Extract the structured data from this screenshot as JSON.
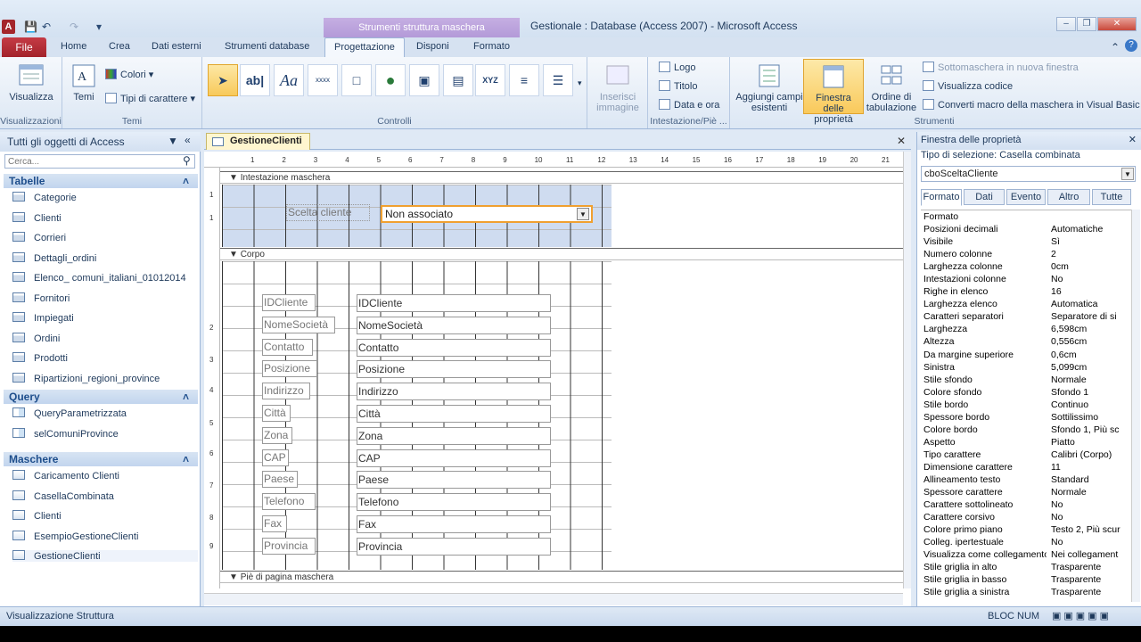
{
  "title_bar": {
    "window_title": "Gestionale : Database (Access 2007)  -  Microsoft Access",
    "context_tab_header": "Strumenti struttura maschera",
    "app_icon": "A"
  },
  "ribbon_tabs": {
    "file": "File",
    "tabs": [
      "Home",
      "Crea",
      "Dati esterni",
      "Strumenti database",
      "Progettazione",
      "Disponi",
      "Formato"
    ],
    "active": "Progettazione"
  },
  "ribbon": {
    "visualizzazioni": {
      "label": "Visualizzazioni",
      "button": "Visualizza"
    },
    "temi": {
      "label": "Temi",
      "temi_button": "Temi",
      "colori": "Colori",
      "tipi_carattere": "Tipi di carattere"
    },
    "controlli": {
      "label": "Controlli",
      "inserisci_immagine": "Inserisci immagine"
    },
    "intestazione": {
      "label": "Intestazione/Piè ...",
      "logo": "Logo",
      "titolo": "Titolo",
      "data_ora": "Data e ora"
    },
    "strumenti": {
      "label": "Strumenti",
      "aggiungi": "Aggiungi campi esistenti",
      "finestra": "Finestra delle proprietà",
      "ordine": "Ordine di tabulazione",
      "sottomaschera": "Sottomaschera in nuova finestra",
      "visualizza_codice": "Visualizza codice",
      "converti": "Converti macro della maschera in Visual Basic"
    }
  },
  "nav": {
    "header": "Tutti gli oggetti di Access",
    "search_placeholder": "Cerca...",
    "sections": [
      {
        "title": "Tabelle",
        "items": [
          "Categorie",
          "Clienti",
          "Corrieri",
          "Dettagli_ordini",
          "Elenco_ comuni_italiani_01012014",
          "Fornitori",
          "Impiegati",
          "Ordini",
          "Prodotti",
          "Ripartizioni_regioni_province"
        ]
      },
      {
        "title": "Query",
        "items": [
          "QueryParametrizzata",
          "selComuniProvince"
        ]
      },
      {
        "title": "Maschere",
        "items": [
          "Caricamento Clienti",
          "CasellaCombinata",
          "Clienti",
          "EsempioGestioneClienti",
          "GestioneClienti"
        ]
      }
    ]
  },
  "document": {
    "tab": "GestioneClienti",
    "sections": {
      "header": "Intestazione maschera",
      "body": "Corpo",
      "footer": "Piè di pagina maschera"
    },
    "header_label": "Scelta cliente",
    "combo_value": "Non associato",
    "fields": [
      {
        "label": "IDCliente",
        "value": "IDCliente"
      },
      {
        "label": "NomeSocietà",
        "value": "NomeSocietà"
      },
      {
        "label": "Contatto",
        "value": "Contatto"
      },
      {
        "label": "Posizione",
        "value": "Posizione"
      },
      {
        "label": "Indirizzo",
        "value": "Indirizzo"
      },
      {
        "label": "Città",
        "value": "Città"
      },
      {
        "label": "Zona",
        "value": "Zona"
      },
      {
        "label": "CAP",
        "value": "CAP"
      },
      {
        "label": "Paese",
        "value": "Paese"
      },
      {
        "label": "Telefono",
        "value": "Telefono"
      },
      {
        "label": "Fax",
        "value": "Fax"
      },
      {
        "label": "Provincia",
        "value": "Provincia"
      }
    ],
    "ruler_numbers": [
      "1",
      "2",
      "3",
      "4",
      "5",
      "6",
      "7",
      "8",
      "9",
      "10",
      "11",
      "12",
      "13",
      "14",
      "15",
      "16",
      "17",
      "18",
      "19",
      "20",
      "21"
    ],
    "vruler_numbers": [
      "1",
      "1",
      "2",
      "3",
      "4",
      "5",
      "6",
      "7",
      "8",
      "9"
    ]
  },
  "properties": {
    "title": "Finestra delle proprietà",
    "selection_type_label": "Tipo di selezione:  Casella combinata",
    "selected_control": "cboSceltaCliente",
    "tabs": [
      "Formato",
      "Dati",
      "Evento",
      "Altro",
      "Tutte"
    ],
    "active_tab": "Formato",
    "rows": [
      [
        "Formato",
        ""
      ],
      [
        "Posizioni decimali",
        "Automatiche"
      ],
      [
        "Visibile",
        "Sì"
      ],
      [
        "Numero colonne",
        "2"
      ],
      [
        "Larghezza colonne",
        "0cm"
      ],
      [
        "Intestazioni colonne",
        "No"
      ],
      [
        "Righe in elenco",
        "16"
      ],
      [
        "Larghezza elenco",
        "Automatica"
      ],
      [
        "Caratteri separatori",
        "Separatore di si"
      ],
      [
        "Larghezza",
        "6,598cm"
      ],
      [
        "Altezza",
        "0,556cm"
      ],
      [
        "Da margine superiore",
        "0,6cm"
      ],
      [
        "Sinistra",
        "5,099cm"
      ],
      [
        "Stile sfondo",
        "Normale"
      ],
      [
        "Colore sfondo",
        "Sfondo 1"
      ],
      [
        "Stile bordo",
        "Continuo"
      ],
      [
        "Spessore bordo",
        "Sottilissimo"
      ],
      [
        "Colore bordo",
        "Sfondo 1, Più sc"
      ],
      [
        "Aspetto",
        "Piatto"
      ],
      [
        "Tipo carattere",
        "Calibri (Corpo)"
      ],
      [
        "Dimensione carattere",
        "11"
      ],
      [
        "Allineamento testo",
        "Standard"
      ],
      [
        "Spessore carattere",
        "Normale"
      ],
      [
        "Carattere sottolineato",
        "No"
      ],
      [
        "Carattere corsivo",
        "No"
      ],
      [
        "Colore primo piano",
        "Testo 2, Più scur"
      ],
      [
        "Colleg. ipertestuale",
        "No"
      ],
      [
        "Visualizza come collegamento",
        "Nei collegament"
      ],
      [
        "Stile griglia in alto",
        "Trasparente"
      ],
      [
        "Stile griglia in basso",
        "Trasparente"
      ],
      [
        "Stile griglia a sinistra",
        "Trasparente"
      ]
    ]
  },
  "status": {
    "left": "Visualizzazione Struttura",
    "right": "BLOC NUM"
  }
}
